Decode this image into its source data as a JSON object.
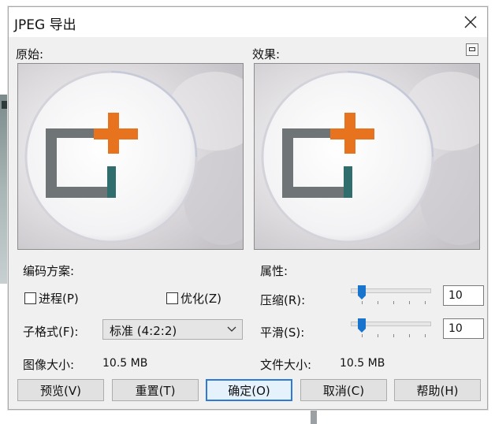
{
  "window": {
    "title": "JPEG 导出"
  },
  "preview": {
    "original_label": "原始:",
    "effect_label": "效果:"
  },
  "encoding": {
    "label": "编码方案:",
    "progressive_label": "进程(P)",
    "progressive_checked": false,
    "optimize_label": "优化(Z)",
    "optimize_checked": false,
    "subformat_label": "子格式(F):",
    "subformat_value": "标准 (4:2:2)",
    "image_size_label": "图像大小:",
    "image_size_value": "10.5 MB"
  },
  "properties": {
    "label": "属性:",
    "compression_label": "压缩(R):",
    "compression_value": "10",
    "smoothing_label": "平滑(S):",
    "smoothing_value": "10",
    "file_size_label": "文件大小:",
    "file_size_value": "10.5 MB"
  },
  "buttons": {
    "preview": "预览(V)",
    "reset": "重置(T)",
    "ok": "确定(O)",
    "cancel": "取消(C)",
    "help": "帮助(H)"
  },
  "icons": {
    "close": "close-icon",
    "preview_toggle": "preview-toggle-icon",
    "dropdown": "chevron-down-icon"
  },
  "colors": {
    "dialog_bg": "#f0f0f0",
    "accent": "#2f7ad6",
    "logo_orange": "#e8731f",
    "logo_gray": "#6f7477"
  }
}
